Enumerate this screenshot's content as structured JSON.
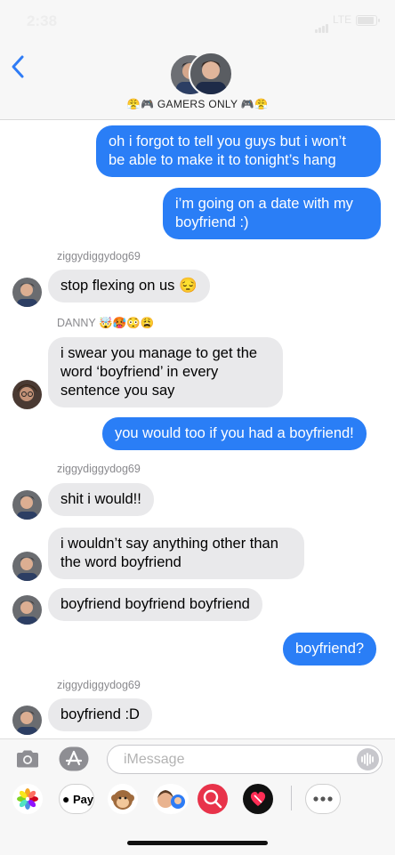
{
  "status_bar": {
    "time": "2:38",
    "network": "LTE",
    "battery_level": 0.85
  },
  "header": {
    "back_icon": "chevron-left-icon",
    "group_name": "😤🎮 GAMERS ONLY 🎮😤"
  },
  "messages": [
    {
      "type": "sent",
      "text": "oh i forgot to tell you guys but i won’t\nbe able to make it to tonight’s hang"
    },
    {
      "type": "sent",
      "text": "i’m going on a date with my\nboyfriend :)"
    },
    {
      "type": "sender",
      "text": "ziggydiggydog69"
    },
    {
      "type": "received",
      "text": "stop flexing on us 😔"
    },
    {
      "type": "sender",
      "text": "DANNY 🤯🥵😳😩"
    },
    {
      "type": "received",
      "text": "i swear you manage to get the\nword ‘boyfriend’ in every\nsentence you say"
    },
    {
      "type": "sent",
      "text": "you would too if you had a boyfriend!"
    },
    {
      "type": "sender",
      "text": "ziggydiggydog69"
    },
    {
      "type": "received",
      "text": "shit i would!!"
    },
    {
      "type": "received",
      "text": "i wouldn’t say anything other than\nthe word boyfriend"
    },
    {
      "type": "received",
      "text": "boyfriend boyfriend boyfriend"
    },
    {
      "type": "sent",
      "text": "boyfriend?"
    },
    {
      "type": "sender",
      "text": "ziggydiggydog69"
    },
    {
      "type": "received",
      "text": "boyfriend :D"
    }
  ],
  "input": {
    "placeholder": "iMessage"
  },
  "drawer": {
    "apple_pay_label": "Pay"
  },
  "icons": {
    "camera": "camera-icon",
    "app_store": "app-store-icon",
    "mic": "audio-waveform-icon",
    "photos": "photos-icon",
    "animoji": "monkey-animoji-icon",
    "memoji": "memoji-icon",
    "search": "image-search-icon",
    "heart": "digital-touch-heart-icon",
    "more": "more-icon"
  },
  "colors": {
    "sent": "#2a7ef6",
    "received": "#e9e9eb",
    "accent": "#2f7cf6"
  }
}
